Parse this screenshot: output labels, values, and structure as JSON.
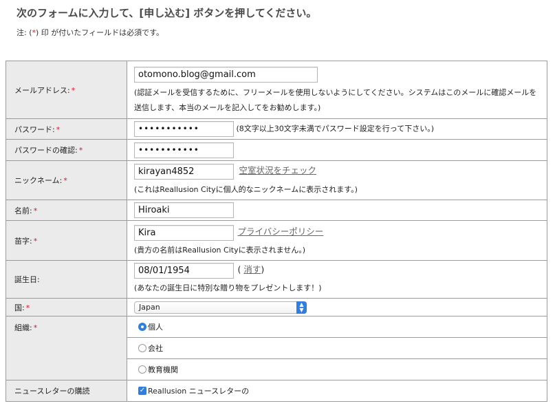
{
  "header": {
    "title": "次のフォームに入力して、[申し込む] ボタンを押してください。",
    "note_prefix": "注: (",
    "note_asterisk": "*",
    "note_suffix": ") 印 が付いたフィールドは必須です。"
  },
  "required_mark": "*",
  "form": {
    "email": {
      "label": "メールアドレス:",
      "value": "otomono.blog@gmail.com",
      "hint": "(認証メールを受信するために、フリーメールを使用しないようにしてください。システムはこのメールに確認メールを送信します、本当のメールを記入してをお勧めします。)"
    },
    "password": {
      "label": "パスワード:",
      "value": "•••••••••••",
      "hint": "(8文字以上30文字未満でパスワード設定を行って下さい。)"
    },
    "password_confirm": {
      "label": "パスワードの確認:",
      "value": "•••••••••••"
    },
    "nickname": {
      "label": "ニックネーム:",
      "value": "kirayan4852",
      "link": "空室状況をチェック",
      "hint": "(これはReallusion Cityに個人的なニックネームに表示されます。)"
    },
    "first_name": {
      "label": "名前:",
      "value": "Hiroaki"
    },
    "last_name": {
      "label": "苗字:",
      "value": "Kira",
      "link": "プライバシーポリシー",
      "hint": "(貴方の名前はReallusion Cityに表示されません。)"
    },
    "birthday": {
      "label": "誕生日:",
      "value": "08/01/1954",
      "clear_prefix": "(",
      "clear_link": "消す",
      "clear_suffix": ")",
      "hint": "(あなたの誕生日に特別な贈り物をプレゼントします！)"
    },
    "country": {
      "label": "国:",
      "value": "Japan"
    },
    "organization": {
      "label": "組織:",
      "options": [
        "個人",
        "会社",
        "教育機関"
      ],
      "selected": "個人"
    },
    "newsletter": {
      "label": "ニュースレターの購読",
      "checkbox_label": "Reallusion ニュースレターの",
      "checked": true
    }
  },
  "colors": {
    "label_bg": "#ebebeb",
    "border": "#9a9a9a",
    "required": "#e0102a",
    "accent": "#2f7ee0"
  }
}
